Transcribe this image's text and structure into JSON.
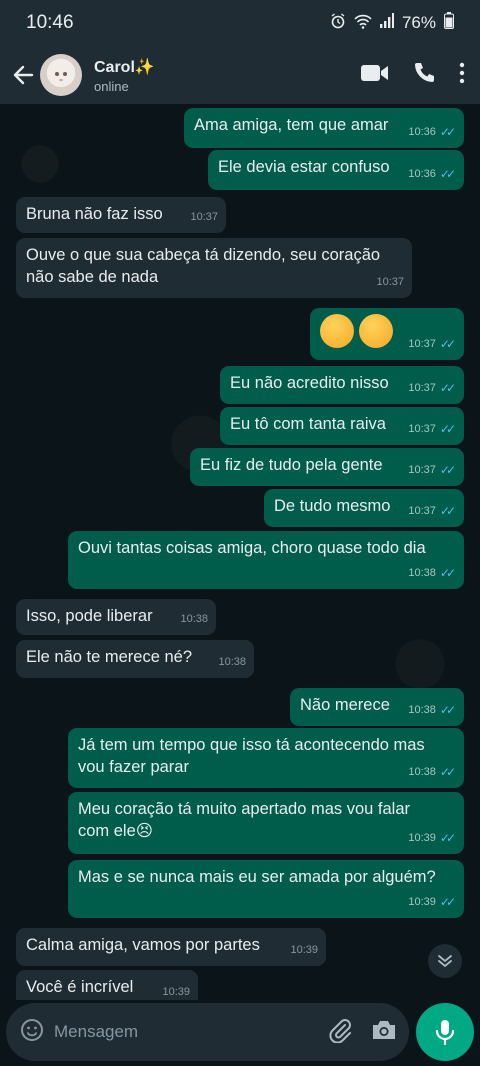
{
  "status_bar": {
    "time": "10:46",
    "battery": "76%"
  },
  "header": {
    "contact_name": "Carol✨",
    "status": "online"
  },
  "messages": [
    {
      "dir": "out",
      "text": "Ama amiga, tem que amar",
      "time": "10:36"
    },
    {
      "dir": "out",
      "text": "Ele devia estar confuso",
      "time": "10:36"
    },
    {
      "dir": "in",
      "text": "Bruna não faz isso",
      "time": "10:37"
    },
    {
      "dir": "in",
      "text": "Ouve o que sua cabeça tá dizendo, seu coração não sabe de nada",
      "time": "10:37"
    },
    {
      "dir": "out",
      "text": "😖😖",
      "time": "10:37"
    },
    {
      "dir": "out",
      "text": "Eu não acredito nisso",
      "time": "10:37"
    },
    {
      "dir": "out",
      "text": "Eu tô com tanta raiva",
      "time": "10:37"
    },
    {
      "dir": "out",
      "text": "Eu fiz de tudo pela gente",
      "time": "10:37"
    },
    {
      "dir": "out",
      "text": "De tudo mesmo",
      "time": "10:37"
    },
    {
      "dir": "out",
      "text": "Ouvi tantas coisas amiga, choro quase todo dia",
      "time": "10:38"
    },
    {
      "dir": "in",
      "text": "Isso, pode liberar",
      "time": "10:38"
    },
    {
      "dir": "in",
      "text": "Ele não te merece né?",
      "time": "10:38"
    },
    {
      "dir": "out",
      "text": "Não merece",
      "time": "10:38"
    },
    {
      "dir": "out",
      "text": "Já tem um tempo que isso tá acontecendo mas vou fazer parar",
      "time": "10:38"
    },
    {
      "dir": "out",
      "text": "Meu coração tá muito apertado mas vou falar com ele😣",
      "time": "10:39"
    },
    {
      "dir": "out",
      "text": "Mas e se nunca mais eu ser amada por alguém?",
      "time": "10:39"
    },
    {
      "dir": "in",
      "text": "Calma amiga, vamos por partes",
      "time": "10:39"
    },
    {
      "dir": "in",
      "text": "Você é incrível",
      "time": "10:39"
    }
  ],
  "composer": {
    "placeholder": "Mensagem"
  },
  "colors": {
    "outgoing_bubble": "#005c4b",
    "incoming_bubble": "#1f2c33",
    "accent": "#00a884",
    "read_ticks": "#53bdeb"
  },
  "icons": [
    "back-arrow-icon",
    "video-call-icon",
    "phone-icon",
    "more-options-icon",
    "emoji-icon",
    "attach-icon",
    "camera-icon",
    "mic-icon",
    "scroll-down-icon"
  ]
}
